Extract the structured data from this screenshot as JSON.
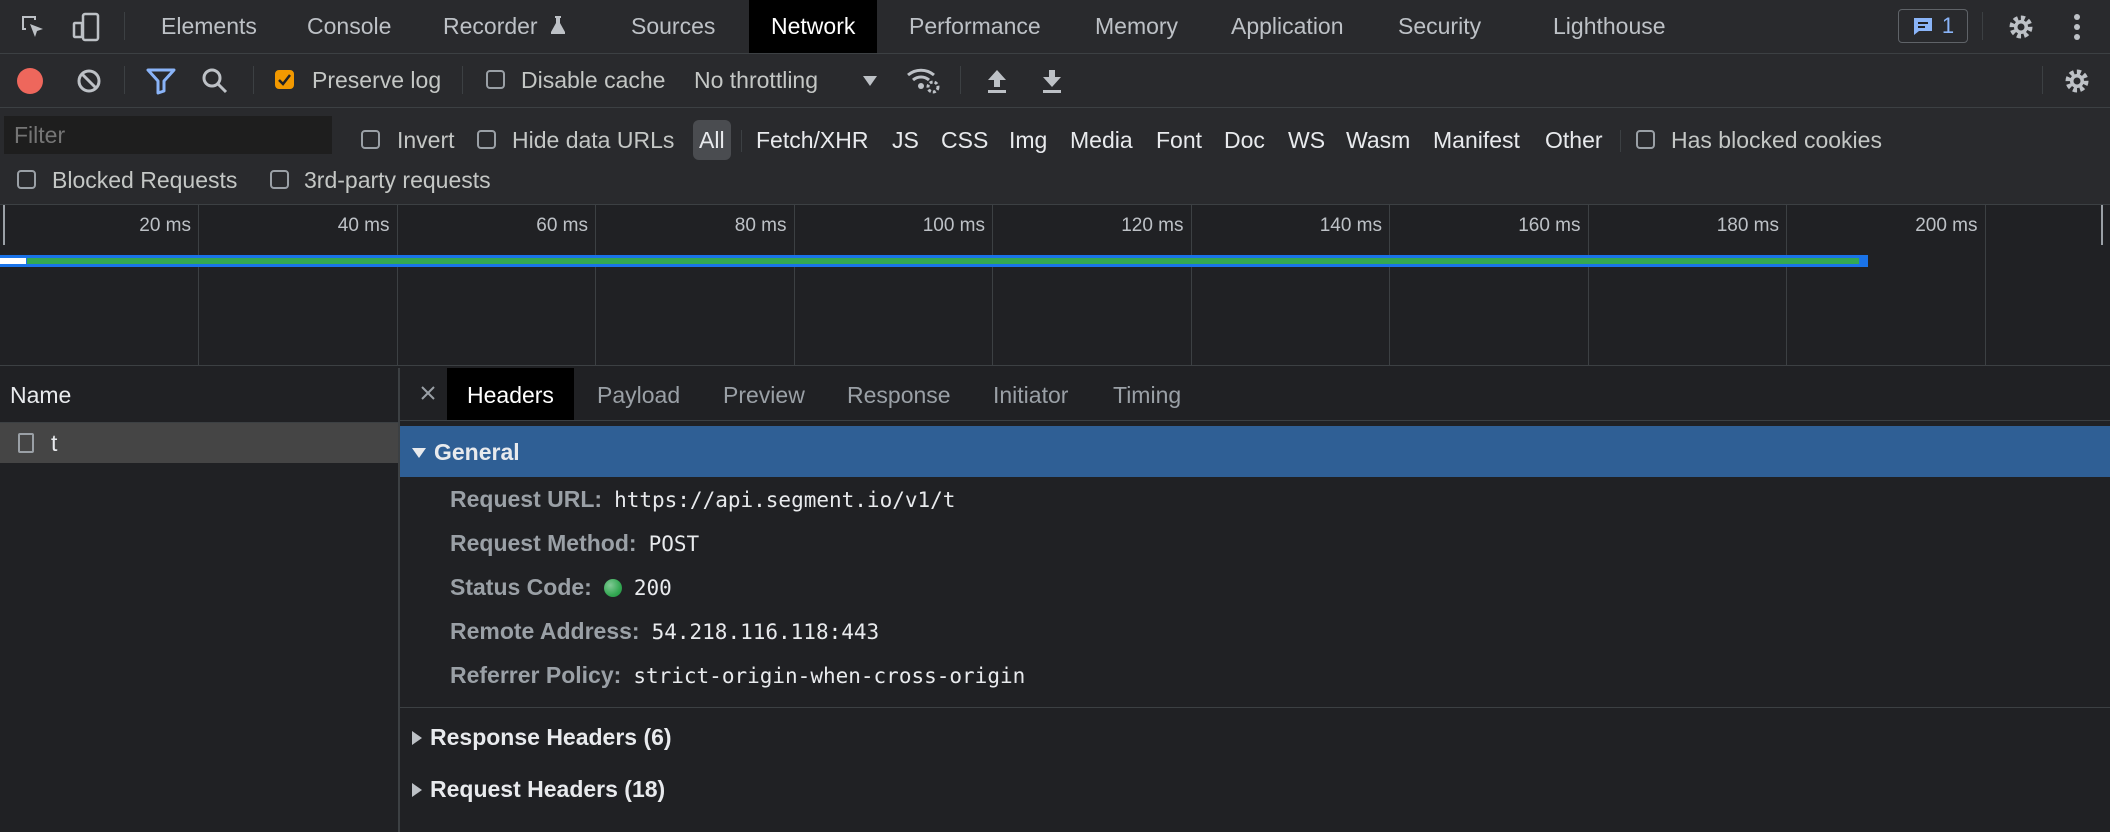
{
  "top_tabs": {
    "elements": "Elements",
    "console": "Console",
    "recorder": "Recorder",
    "sources": "Sources",
    "network": "Network",
    "performance": "Performance",
    "memory": "Memory",
    "application": "Application",
    "security": "Security",
    "lighthouse": "Lighthouse"
  },
  "issues_count": "1",
  "toolbar": {
    "preserve_log": "Preserve log",
    "disable_cache": "Disable cache",
    "throttling": "No throttling"
  },
  "filter": {
    "placeholder": "Filter",
    "invert": "Invert",
    "hide_data_urls": "Hide data URLs",
    "types": [
      "All",
      "Fetch/XHR",
      "JS",
      "CSS",
      "Img",
      "Media",
      "Font",
      "Doc",
      "WS",
      "Wasm",
      "Manifest",
      "Other"
    ],
    "has_blocked_cookies": "Has blocked cookies",
    "blocked_requests": "Blocked Requests",
    "third_party": "3rd-party requests"
  },
  "overview": {
    "ticks": [
      "20 ms",
      "40 ms",
      "60 ms",
      "80 ms",
      "100 ms",
      "120 ms",
      "140 ms",
      "160 ms",
      "180 ms",
      "200 ms"
    ]
  },
  "requests": {
    "column_name": "Name",
    "rows": [
      "t"
    ]
  },
  "detail_tabs": {
    "headers": "Headers",
    "payload": "Payload",
    "preview": "Preview",
    "response": "Response",
    "initiator": "Initiator",
    "timing": "Timing"
  },
  "general": {
    "title": "General",
    "request_url_label": "Request URL:",
    "request_url": "https://api.segment.io/v1/t",
    "request_method_label": "Request Method:",
    "request_method": "POST",
    "status_code_label": "Status Code:",
    "status_code": "200",
    "remote_address_label": "Remote Address:",
    "remote_address": "54.218.116.118:443",
    "referrer_policy_label": "Referrer Policy:",
    "referrer_policy": "strict-origin-when-cross-origin"
  },
  "response_headers": "Response Headers (6)",
  "request_headers": "Request Headers (18)",
  "colors": {
    "status_green": "#34a853",
    "selected_section": "#2f5f95",
    "accent_blue": "#8ab4f8",
    "checkbox_orange": "#f29900"
  }
}
